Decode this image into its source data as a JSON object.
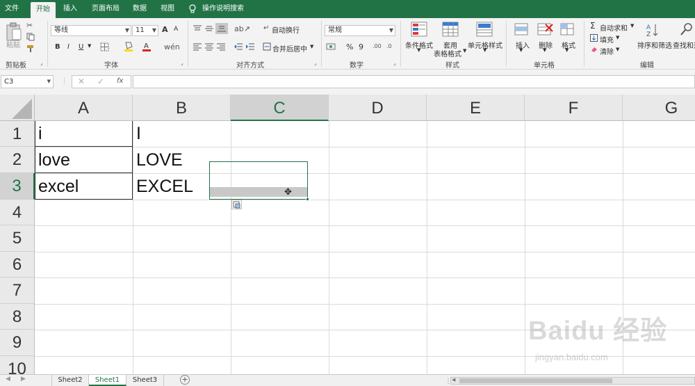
{
  "menu": [
    "文件",
    "开始",
    "插入",
    "页面布局",
    "数据",
    "视图"
  ],
  "menu_active": "开始",
  "tell_me": "操作说明搜索",
  "ribbon": {
    "paste": "粘贴",
    "clipboard_group": "剪贴板",
    "font_name": "等线",
    "font_size": "11",
    "bold": "B",
    "italic": "I",
    "underline": "U",
    "grow_font": "A",
    "shrink_font": "A",
    "font_group": "字体",
    "wrap_text": "自动换行",
    "merge_center": "合并后居中",
    "align_group": "对齐方式",
    "number_format": "常规",
    "percent": "%",
    "comma": "9",
    "number_group": "数字",
    "conditional_format": "条件格式",
    "table_format_1": "套用",
    "table_format_2": "表格格式",
    "cell_styles": "单元格样式",
    "styles_group": "样式",
    "insert": "插入",
    "delete": "删除",
    "format": "格式",
    "cells_group": "单元格",
    "autosum": "自动求和",
    "fill": "填充",
    "clear": "清除",
    "sort_filter": "排序和筛选",
    "find_select": "查找和选",
    "editing_group": "编辑"
  },
  "name_box": "C3",
  "formula_value": "",
  "fx": "fx",
  "columns": [
    "A",
    "B",
    "C",
    "D",
    "E",
    "F",
    "G"
  ],
  "selected_column": "C",
  "rows": [
    "1",
    "2",
    "3",
    "4",
    "5",
    "6",
    "7",
    "8",
    "9",
    "10"
  ],
  "selected_row": "3",
  "cells": {
    "A1": "i",
    "A2": "love",
    "A3": "excel",
    "B1": "I",
    "B2": "LOVE",
    "B3": "EXCEL"
  },
  "sheets": [
    "Sheet2",
    "Sheet1",
    "Sheet3"
  ],
  "active_sheet": "Sheet1",
  "watermark": "Baidu 经验",
  "watermark_url": "jingyan.baidu.com",
  "colors": {
    "accent": "#217346",
    "ribbon": "#f3f3f3",
    "header": "#e9e9e9"
  }
}
